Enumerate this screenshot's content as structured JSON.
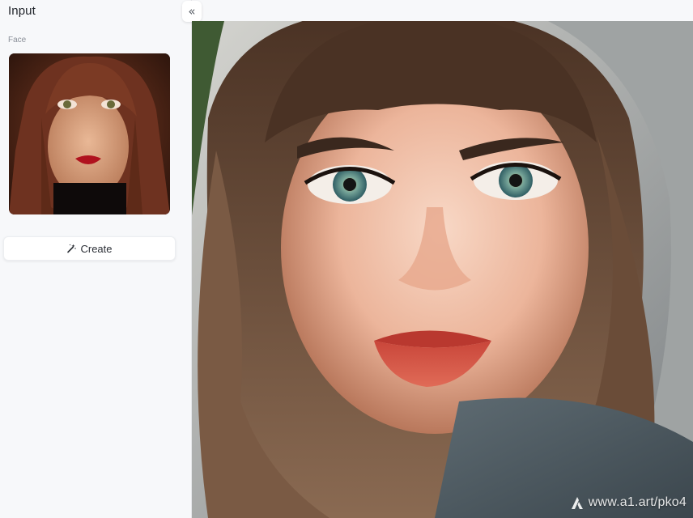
{
  "sidebar": {
    "title": "Input",
    "face_label": "Face",
    "create_label": "Create",
    "collapse_glyph": "«"
  },
  "result": {
    "watermark": "www.a1.art/pko4"
  },
  "icons": {
    "collapse": "double-chevron-left-icon",
    "create": "magic-wand-icon",
    "watermark": "a1-logo-icon"
  },
  "colors": {
    "background": "#f7f8fa",
    "button_bg": "#ffffff",
    "text": "#1f2329",
    "muted": "#8a8f98"
  }
}
